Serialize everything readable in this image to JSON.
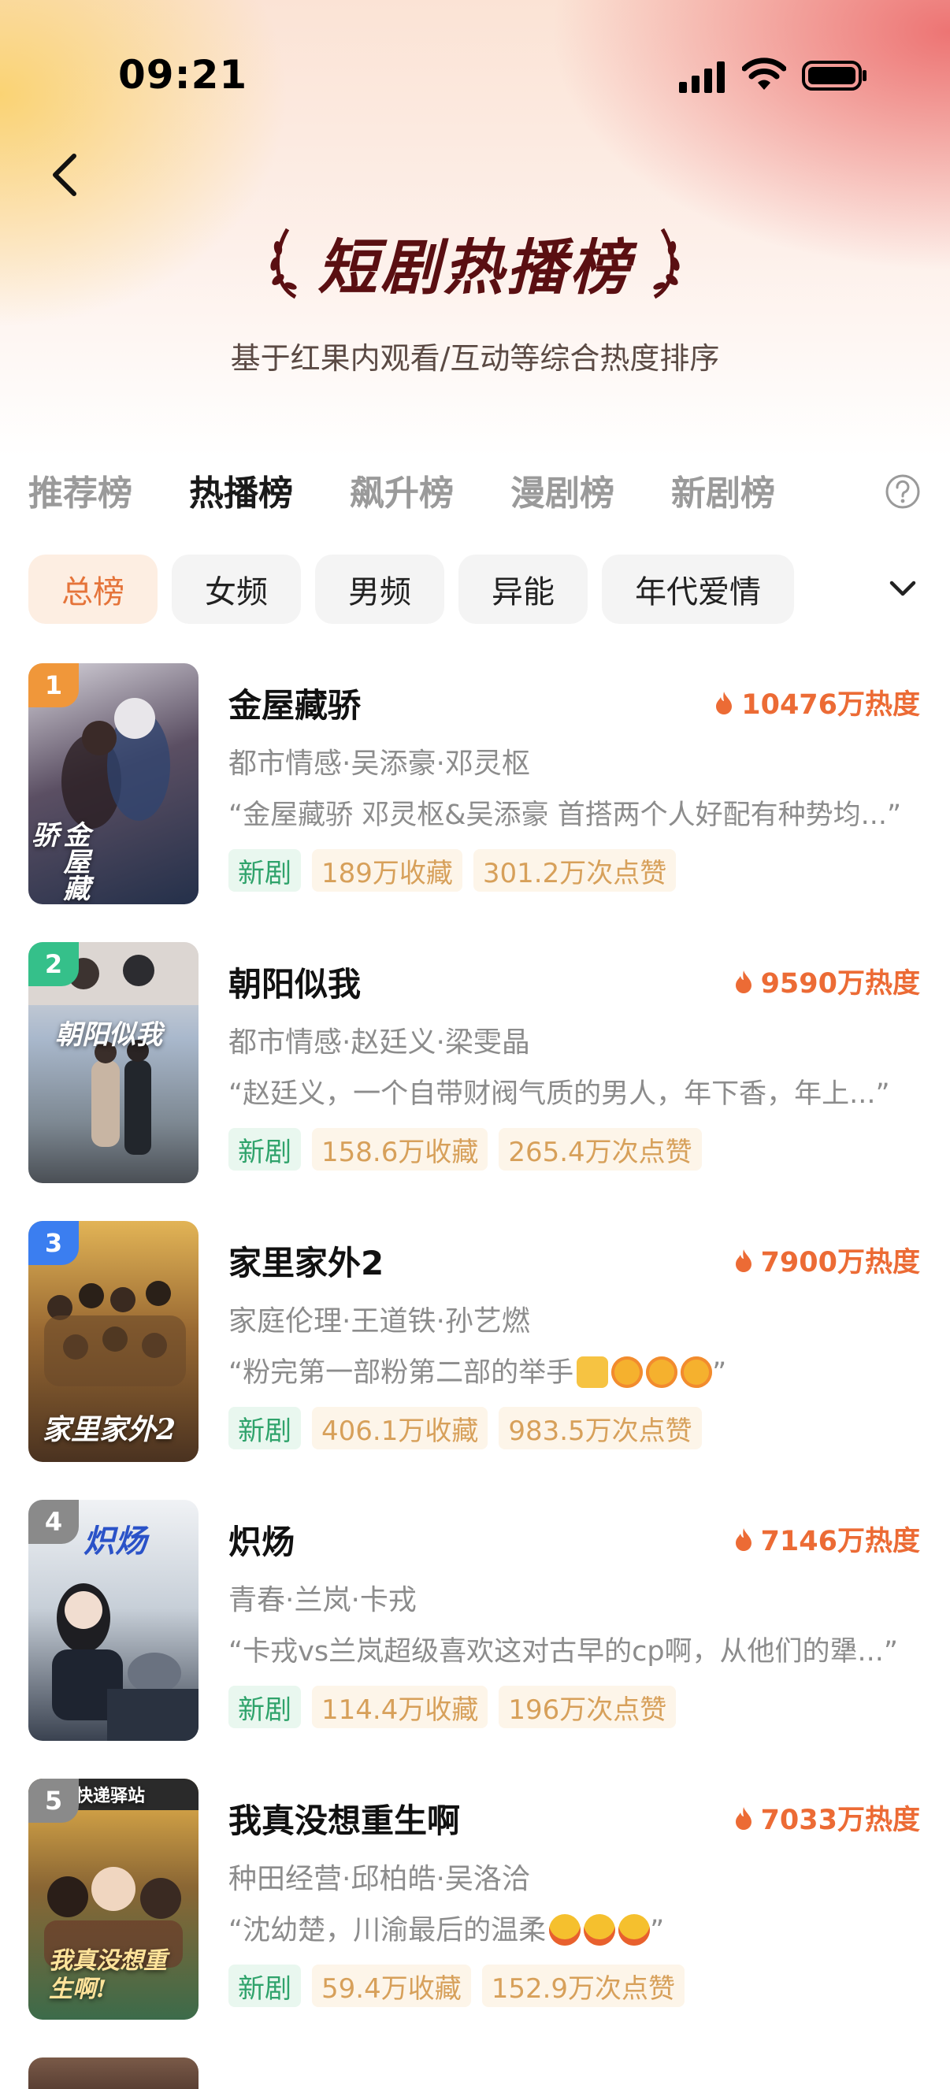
{
  "status_bar": {
    "time": "09:21"
  },
  "header": {
    "title": "短剧热播榜",
    "subtitle": "基于红果内观看/互动等综合热度排序"
  },
  "rank_tabs": [
    {
      "label": "推荐榜",
      "active": false
    },
    {
      "label": "热播榜",
      "active": true
    },
    {
      "label": "飙升榜",
      "active": false
    },
    {
      "label": "漫剧榜",
      "active": false
    },
    {
      "label": "新剧榜",
      "active": false
    }
  ],
  "filter_chips": [
    {
      "label": "总榜",
      "active": true
    },
    {
      "label": "女频",
      "active": false
    },
    {
      "label": "男频",
      "active": false
    },
    {
      "label": "异能",
      "active": false
    },
    {
      "label": "年代爱情",
      "active": false
    }
  ],
  "dramas": [
    {
      "rank": "1",
      "title": "金屋藏骄",
      "heat": "10476万热度",
      "tags": "都市情感·吴添豪·邓灵枢",
      "quote": "“金屋藏骄 邓灵枢&吴添豪 首搭两个人好配有种势均...”",
      "badge_new": "新剧",
      "favorites": "189万收藏",
      "likes": "301.2万次点赞",
      "poster_text": "金屋藏骄",
      "rank_color": "#f0973a",
      "poster_colors": [
        "#c9c6cf",
        "#3b3042",
        "#27324a"
      ]
    },
    {
      "rank": "2",
      "title": "朝阳似我",
      "heat": "9590万热度",
      "tags": "都市情感·赵廷义·梁雯晶",
      "quote": "“赵廷义，一个自带财阀气质的男人，年下香，年上...”",
      "badge_new": "新剧",
      "favorites": "158.6万收藏",
      "likes": "265.4万次点赞",
      "poster_text": "朝阳似我",
      "rank_color": "#35c08a",
      "poster_colors": [
        "#cfd8e6",
        "#a9b6c9",
        "#6f7a86"
      ]
    },
    {
      "rank": "3",
      "title": "家里家外2",
      "heat": "7900万热度",
      "tags": "家庭伦理·王道铁·孙艺燃",
      "quote": "“粉完第一部粉第二部的举手",
      "quote_end": "”",
      "badge_new": "新剧",
      "favorites": "406.1万收藏",
      "likes": "983.5万次点赞",
      "poster_text": "家里家外2",
      "rank_color": "#3b7ef0",
      "poster_colors": [
        "#d9a64a",
        "#8a5a2a",
        "#4a3220"
      ]
    },
    {
      "rank": "4",
      "title": "炽炀",
      "heat": "7146万热度",
      "tags": "青春·兰岚·卡戎",
      "quote": "“卡戎vs兰岚超级喜欢这对古早的cp啊，从他们的犟...”",
      "badge_new": "新剧",
      "favorites": "114.4万收藏",
      "likes": "196万次点赞",
      "poster_text": "炽炀",
      "rank_color": "#8a8a8a",
      "poster_colors": [
        "#e9edf2",
        "#b9c2cc",
        "#3a4250"
      ]
    },
    {
      "rank": "5",
      "title": "我真没想重生啊",
      "heat": "7033万热度",
      "tags": "种田经营·邱柏皓·吴洛洽",
      "quote": "“沈幼楚，川渝最后的温柔",
      "quote_end": "”",
      "badge_new": "新剧",
      "favorites": "59.4万收藏",
      "likes": "152.9万次点赞",
      "poster_text": "我真没想重生啊!",
      "poster_sign": "快递驿站",
      "rank_color": "#8a8a8a",
      "poster_colors": [
        "#e3b04a",
        "#7a5a30",
        "#3a6a4a"
      ]
    }
  ],
  "colors": {
    "accent_orange": "#ec6b35",
    "title_dark_red": "#5a0f12",
    "new_badge_green": "#2fa36b",
    "stat_badge_gold": "#d7a05a"
  }
}
